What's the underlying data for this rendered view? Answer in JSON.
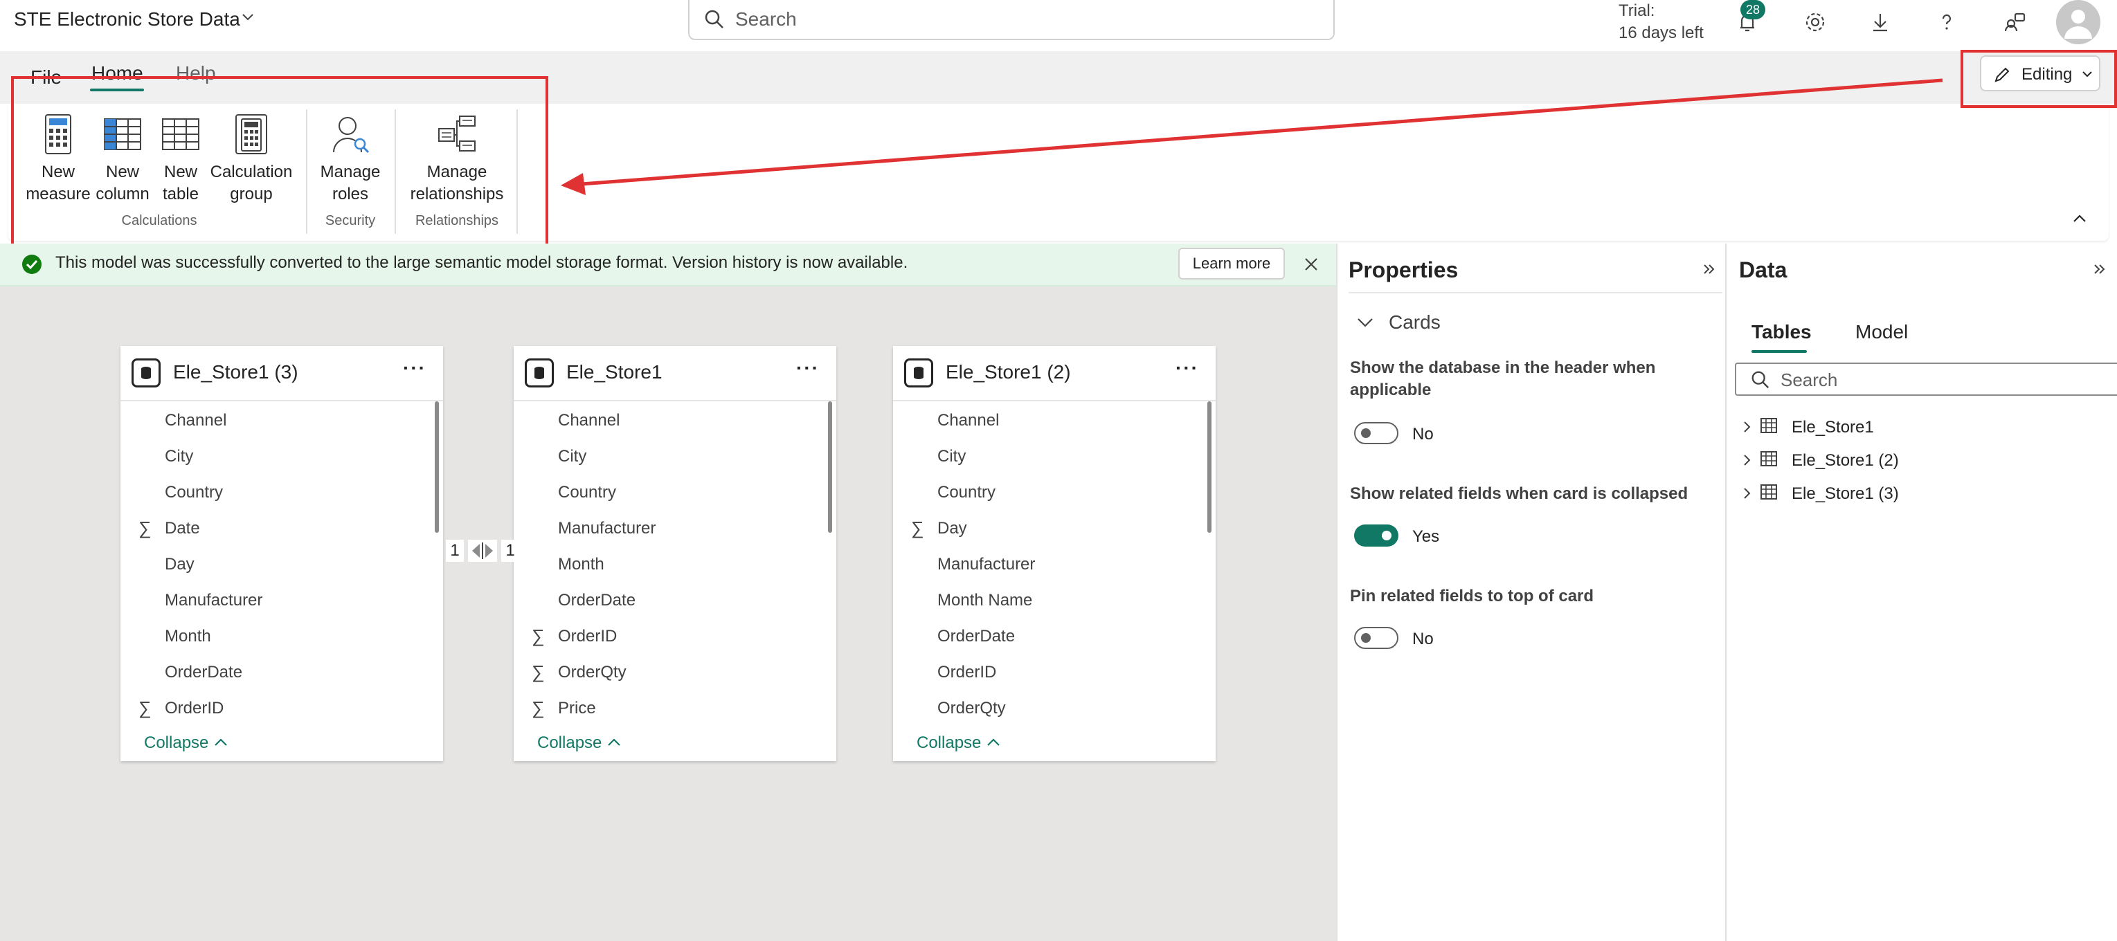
{
  "app": {
    "title": "STE Electronic Store Data",
    "search_placeholder": "Search",
    "trial_line1": "Trial:",
    "trial_line2": "16 days left",
    "notification_count": "28"
  },
  "ribbon": {
    "tabs": [
      "File",
      "Home",
      "Help"
    ],
    "active_tab": "Home",
    "mode_button": "Editing",
    "buttons": {
      "new_measure": "New\nmeasure",
      "new_column": "New\ncolumn",
      "new_table": "New\ntable",
      "calculation_group": "Calculation\ngroup",
      "manage_roles": "Manage\nroles",
      "manage_relationships": "Manage\nrelationships"
    },
    "groups": {
      "calculations": "Calculations",
      "security": "Security",
      "relationships": "Relationships"
    }
  },
  "banner": {
    "message": "This model was successfully converted to the large semantic model storage format. Version history is now available.",
    "learn_more": "Learn more"
  },
  "cards": [
    {
      "title": "Ele_Store1 (3)",
      "fields": [
        {
          "name": "Channel",
          "sigma": false
        },
        {
          "name": "City",
          "sigma": false
        },
        {
          "name": "Country",
          "sigma": false
        },
        {
          "name": "Date",
          "sigma": true
        },
        {
          "name": "Day",
          "sigma": false
        },
        {
          "name": "Manufacturer",
          "sigma": false
        },
        {
          "name": "Month",
          "sigma": false
        },
        {
          "name": "OrderDate",
          "sigma": false
        },
        {
          "name": "OrderID",
          "sigma": true
        }
      ],
      "collapse": "Collapse"
    },
    {
      "title": "Ele_Store1",
      "fields": [
        {
          "name": "Channel",
          "sigma": false
        },
        {
          "name": "City",
          "sigma": false
        },
        {
          "name": "Country",
          "sigma": false
        },
        {
          "name": "Manufacturer",
          "sigma": false
        },
        {
          "name": "Month",
          "sigma": false
        },
        {
          "name": "OrderDate",
          "sigma": false
        },
        {
          "name": "OrderID",
          "sigma": true
        },
        {
          "name": "OrderQty",
          "sigma": true
        },
        {
          "name": "Price",
          "sigma": true
        }
      ],
      "collapse": "Collapse"
    },
    {
      "title": "Ele_Store1 (2)",
      "fields": [
        {
          "name": "Channel",
          "sigma": false
        },
        {
          "name": "City",
          "sigma": false
        },
        {
          "name": "Country",
          "sigma": false
        },
        {
          "name": "Day",
          "sigma": true
        },
        {
          "name": "Manufacturer",
          "sigma": false
        },
        {
          "name": "Month Name",
          "sigma": false
        },
        {
          "name": "OrderDate",
          "sigma": false
        },
        {
          "name": "OrderID",
          "sigma": false
        },
        {
          "name": "OrderQty",
          "sigma": false
        }
      ],
      "collapse": "Collapse"
    }
  ],
  "relationship": {
    "left": "1",
    "right": "1"
  },
  "properties": {
    "title": "Properties",
    "section": "Cards",
    "items": [
      {
        "label": "Show the database in the header when applicable",
        "value": "No",
        "on": false
      },
      {
        "label": "Show related fields when card is collapsed",
        "value": "Yes",
        "on": true
      },
      {
        "label": "Pin related fields to top of card",
        "value": "No",
        "on": false
      }
    ]
  },
  "data_pane": {
    "title": "Data",
    "tabs": [
      "Tables",
      "Model"
    ],
    "search_placeholder": "Search",
    "tables": [
      "Ele_Store1",
      "Ele_Store1 (2)",
      "Ele_Store1 (3)"
    ]
  },
  "colors": {
    "accent": "#117865",
    "annotation": "#e03232",
    "banner_bg": "#e6f6ea",
    "canvas_bg": "#e6e5e4"
  }
}
